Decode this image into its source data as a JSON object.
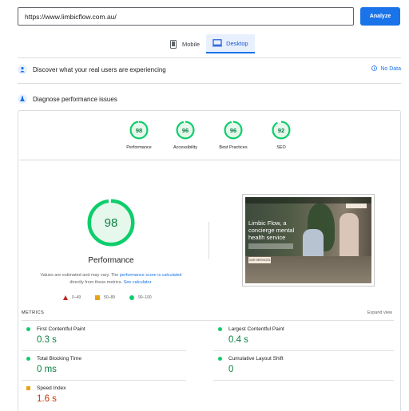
{
  "search": {
    "url_value": "https://www.limbicflow.com.au/",
    "analyze_label": "Analyze"
  },
  "device_tabs": [
    {
      "label": "Mobile",
      "icon": "mobile-phone-icon",
      "active": false
    },
    {
      "label": "Desktop",
      "icon": "desktop-monitor-icon",
      "active": true
    }
  ],
  "field_data": {
    "title": "Discover what your real users are experiencing",
    "no_data": "No Data",
    "icon": "people-icon"
  },
  "diagnose": {
    "title": "Diagnose performance issues",
    "icon": "lab-flask-icon"
  },
  "categories": [
    {
      "label": "Performance",
      "score": "98",
      "value": 98
    },
    {
      "label": "Accessibility",
      "score": "96",
      "value": 96
    },
    {
      "label": "Best Practices",
      "score": "96",
      "value": 96
    },
    {
      "label": "SEO",
      "score": "92",
      "value": 92
    }
  ],
  "performance": {
    "score": "98",
    "value": 98,
    "title": "Performance",
    "note_prefix": "Values are estimated and may vary. The ",
    "note_link1": "performance score is calculated",
    "note_middle": "directly from these metrics. ",
    "note_link2": "See calculator."
  },
  "legend": [
    {
      "label": "0–49",
      "shape": "triangle",
      "color": "#c5221f"
    },
    {
      "label": "50–89",
      "shape": "square",
      "color": "#e8a317"
    },
    {
      "label": "90–100",
      "shape": "circle",
      "color": "#0cce6b"
    }
  ],
  "screenshot": {
    "headline": "Limbic Flow, a concierge mental health service",
    "button": "OUR SERVICES"
  },
  "metrics": {
    "heading": "METRICS",
    "expand_label": "Expand view",
    "items": [
      {
        "label": "First Contentful Paint",
        "value": "0.3 s",
        "rating": "good"
      },
      {
        "label": "Largest Contentful Paint",
        "value": "0.4 s",
        "rating": "good"
      },
      {
        "label": "Total Blocking Time",
        "value": "0 ms",
        "rating": "good"
      },
      {
        "label": "Cumulative Layout Shift",
        "value": "0",
        "rating": "good"
      },
      {
        "label": "Speed Index",
        "value": "1.6 s",
        "rating": "average"
      }
    ]
  },
  "colors": {
    "accent": "#1a73e8",
    "good": "#0cce6b",
    "good_text": "#0b8043",
    "average": "#e8a317",
    "average_text": "#c33300",
    "poor": "#c5221f"
  }
}
